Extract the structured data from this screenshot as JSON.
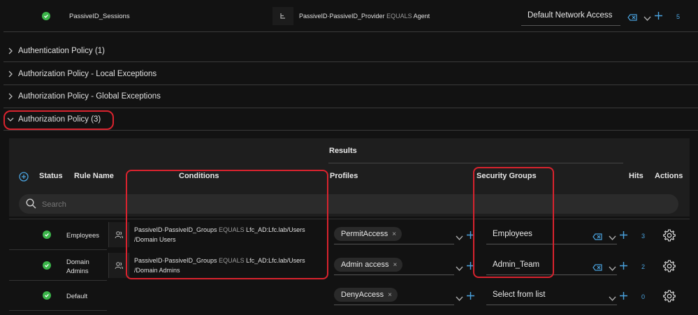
{
  "top_row": {
    "name": "PassiveID_Sessions",
    "condition_attr": "PassiveID·PassiveID_Provider",
    "condition_op": "EQUALS",
    "condition_val": "Agent",
    "result": "Default Network Access",
    "hits": "5"
  },
  "sections": [
    {
      "label": "Authentication Policy (1)"
    },
    {
      "label": "Authorization Policy - Local Exceptions"
    },
    {
      "label": "Authorization Policy - Global Exceptions"
    },
    {
      "label": "Authorization Policy (3)"
    }
  ],
  "table": {
    "results_header": "Results",
    "headers": {
      "status": "Status",
      "rule_name": "Rule Name",
      "conditions": "Conditions",
      "profiles": "Profiles",
      "security_groups": "Security Groups",
      "hits": "Hits",
      "actions": "Actions"
    },
    "search_placeholder": "Search",
    "rows": [
      {
        "name": "Employees",
        "cond_attr": "PassiveID·PassiveID_Groups",
        "cond_op": "EQUALS",
        "cond_val": "Lfc_AD:Lfc.lab/Users",
        "cond_val2": "/Domain Users",
        "profile": "PermitAccess",
        "sg": "Employees",
        "hits": "3"
      },
      {
        "name": "Domain",
        "name2": "Admins",
        "cond_attr": "PassiveID·PassiveID_Groups",
        "cond_op": "EQUALS",
        "cond_val": "Lfc_AD:Lfc.lab/Users",
        "cond_val2": "/Domain Admins",
        "profile": "Admin access",
        "sg": "Admin_Team",
        "hits": "2"
      },
      {
        "name": "Default",
        "profile": "DenyAccess",
        "sg": "Select from list",
        "hits": "0"
      }
    ]
  },
  "icons": {
    "close": "×"
  },
  "colors": {
    "accent": "#4aa3df",
    "ok": "#3bb54a",
    "highlight": "#d9232e"
  }
}
